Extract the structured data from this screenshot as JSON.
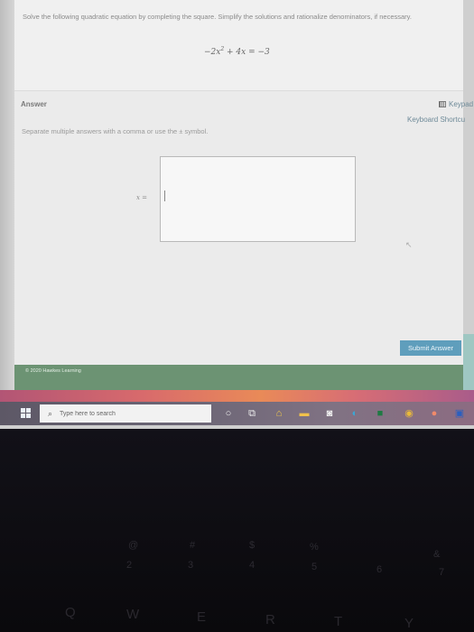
{
  "question": {
    "prompt": "Solve the following quadratic equation by completing the square. Simplify the solutions and rationalize denominators, if necessary.",
    "equation_lhs_a": "−2x",
    "equation_exp": "2",
    "equation_rest": " + 4x = −3"
  },
  "answer": {
    "label": "Answer",
    "keypad_label": "Keypad",
    "shortcuts_label": "Keyboard Shortcu",
    "instructions": "Separate multiple answers with a comma or use the ± symbol.",
    "variable_label": "x =",
    "input_value": ""
  },
  "submit_label": "Submit Answer",
  "footer_text": "© 2020 Hawkes Learning",
  "taskbar": {
    "search_placeholder": "Type here to search",
    "icons": [
      "windows-start-icon",
      "search-icon",
      "cortana-icon",
      "task-view-icon",
      "home-app-icon",
      "file-explorer-icon",
      "camera-app-icon",
      "edge-icon",
      "hawkes-app-icon",
      "chrome-icon",
      "music-app-icon",
      "word-icon"
    ]
  },
  "keyboard": {
    "row_numbers": [
      "@",
      "2",
      "#",
      "3",
      "$",
      "4",
      "%",
      "5",
      "6",
      "&",
      "7"
    ],
    "row_letters": [
      "Q",
      "W",
      "E",
      "R",
      "T",
      "Y"
    ]
  }
}
